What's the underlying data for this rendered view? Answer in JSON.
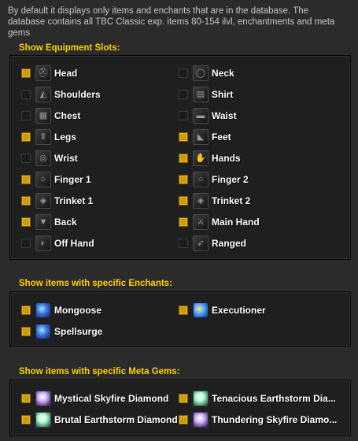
{
  "intro_text": "By default it displays only items and enchants that are in the database. The database contains all TBC Classic exp. items 80-154 ilvl, enchantments and meta gems",
  "slots_section": {
    "title": "Show Equipment Slots:",
    "left": [
      {
        "label": "Head",
        "checked": true,
        "icon": "helm-icon"
      },
      {
        "label": "Shoulders",
        "checked": false,
        "icon": "shoulder-icon"
      },
      {
        "label": "Chest",
        "checked": false,
        "icon": "chest-icon"
      },
      {
        "label": "Legs",
        "checked": true,
        "icon": "legs-icon"
      },
      {
        "label": "Wrist",
        "checked": false,
        "icon": "wrist-icon"
      },
      {
        "label": "Finger 1",
        "checked": true,
        "icon": "ring-icon"
      },
      {
        "label": "Trinket 1",
        "checked": true,
        "icon": "trinket-icon"
      },
      {
        "label": "Back",
        "checked": true,
        "icon": "back-icon"
      },
      {
        "label": "Off Hand",
        "checked": false,
        "icon": "offhand-icon"
      }
    ],
    "right": [
      {
        "label": "Neck",
        "checked": false,
        "icon": "neck-icon"
      },
      {
        "label": "Shirt",
        "checked": false,
        "icon": "shirt-icon"
      },
      {
        "label": "Waist",
        "checked": false,
        "icon": "waist-icon"
      },
      {
        "label": "Feet",
        "checked": true,
        "icon": "feet-icon"
      },
      {
        "label": "Hands",
        "checked": true,
        "icon": "hands-icon"
      },
      {
        "label": "Finger 2",
        "checked": true,
        "icon": "ring-icon"
      },
      {
        "label": "Trinket 2",
        "checked": true,
        "icon": "trinket-icon"
      },
      {
        "label": "Main Hand",
        "checked": true,
        "icon": "mainhand-icon"
      },
      {
        "label": "Ranged",
        "checked": false,
        "icon": "ranged-icon"
      }
    ]
  },
  "enchants_section": {
    "title": "Show items with specific Enchants:",
    "items": [
      {
        "label": "Mongoose",
        "checked": true,
        "icon": "mongoose-enchant-icon"
      },
      {
        "label": "Executioner",
        "checked": true,
        "icon": "executioner-enchant-icon"
      },
      {
        "label": "Spellsurge",
        "checked": true,
        "icon": "spellsurge-enchant-icon"
      }
    ]
  },
  "gems_section": {
    "title": "Show items with specific Meta Gems:",
    "items": [
      {
        "label": "Mystical Skyfire Diamond",
        "checked": true,
        "icon": "skyfire-diamond-icon"
      },
      {
        "label": "Tenacious Earthstorm Dia...",
        "checked": true,
        "icon": "earthstorm-diamond-icon"
      },
      {
        "label": "Brutal Earthstorm Diamond",
        "checked": true,
        "icon": "earthstorm-diamond-icon"
      },
      {
        "label": "Thundering Skyfire Diamo...",
        "checked": true,
        "icon": "skyfire-diamond-icon"
      }
    ]
  },
  "colors": {
    "accent_title": "#ffd100",
    "checked_box": "#c99a12",
    "panel_bg": "#1f1f1f",
    "page_bg": "#2b2b2b"
  }
}
